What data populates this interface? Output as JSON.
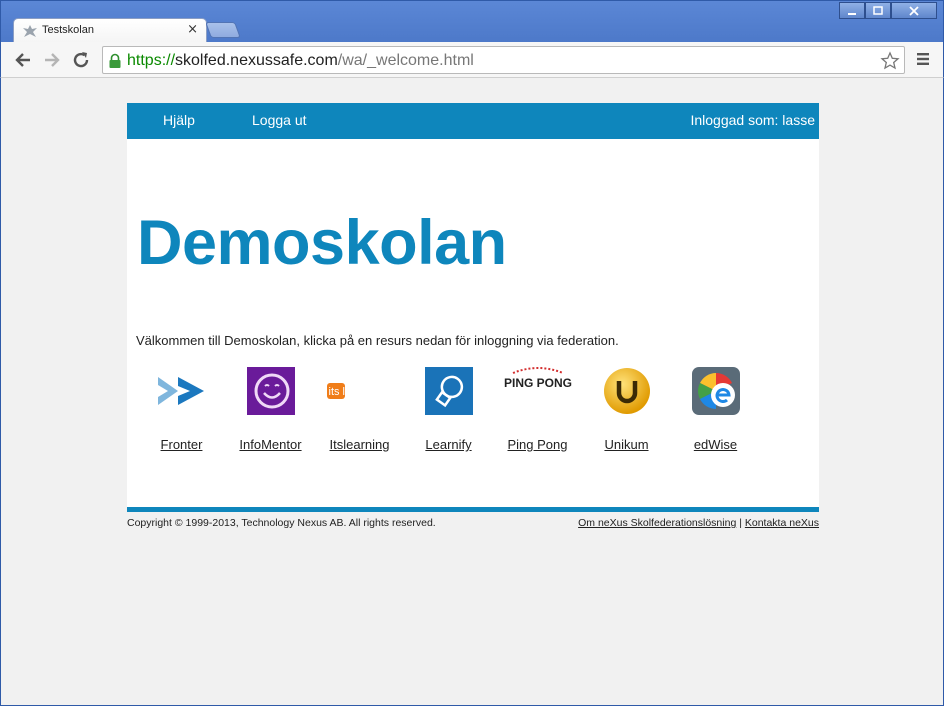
{
  "browser": {
    "tab_title": "Testskolan",
    "tab_close": "×",
    "url_scheme": "https://",
    "url_host": "skolfed.nexussafe.com",
    "url_path": "/wa/_welcome.html",
    "window_buttons": [
      "minimize",
      "maximize",
      "close"
    ]
  },
  "nav": {
    "help_label": "Hjälp",
    "logout_label": "Logga ut",
    "logged_in_label": "Inloggad som: lasse"
  },
  "school": {
    "title": "Demoskolan",
    "welcome": "Välkommen till Demoskolan, klicka på en resurs nedan för inloggning via federation."
  },
  "resources": [
    {
      "label": "Fronter",
      "icon": "fronter-logo"
    },
    {
      "label": "InfoMentor",
      "icon": "infomentor-logo"
    },
    {
      "label": "Itslearning",
      "icon": "itslearning-logo",
      "logo_text": "its learning"
    },
    {
      "label": "Learnify",
      "icon": "learnify-logo"
    },
    {
      "label": "Ping Pong",
      "icon": "pingpong-logo",
      "logo_text": "PING PONG"
    },
    {
      "label": "Unikum",
      "icon": "unikum-logo"
    },
    {
      "label": "edWise",
      "icon": "edwise-logo"
    }
  ],
  "footer": {
    "copyright": "Copyright © 1999-2013, Technology Nexus AB. All rights reserved.",
    "about_link": "Om neXus Skolfederationslösning",
    "separator": "|",
    "contact_link": "Kontakta neXus"
  },
  "colors": {
    "brand": "#0e86bc",
    "chrome": "#4d79c9",
    "secure": "#0b8a00"
  }
}
